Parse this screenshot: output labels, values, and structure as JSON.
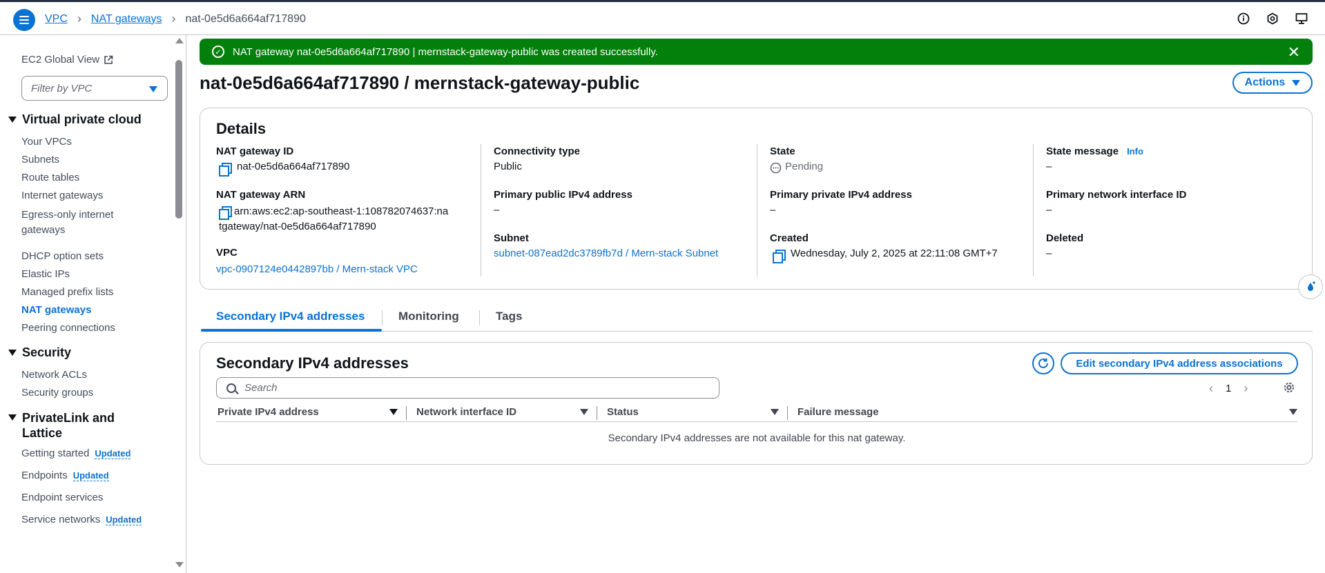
{
  "breadcrumb": {
    "items": [
      "VPC",
      "NAT gateways"
    ],
    "current": "nat-0e5d6a664af717890"
  },
  "sidebar": {
    "global_view": "EC2 Global View",
    "filter_placeholder": "Filter by VPC",
    "sections": [
      {
        "title": "Virtual private cloud",
        "items": [
          "Your VPCs",
          "Subnets",
          "Route tables",
          "Internet gateways",
          "Egress-only internet gateways",
          "DHCP option sets",
          "Elastic IPs",
          "Managed prefix lists",
          "NAT gateways",
          "Peering connections"
        ]
      },
      {
        "title": "Security",
        "items": [
          "Network ACLs",
          "Security groups"
        ]
      },
      {
        "title": "PrivateLink and Lattice",
        "items": [
          "Getting started",
          "Endpoints",
          "Endpoint services",
          "Service networks"
        ]
      }
    ],
    "active_item": "NAT gateways",
    "updated_badge": "Updated"
  },
  "flash": {
    "message": "NAT gateway nat-0e5d6a664af717890 | mernstack-gateway-public was created successfully."
  },
  "page": {
    "title": "nat-0e5d6a664af717890 / mernstack-gateway-public",
    "actions_label": "Actions"
  },
  "details": {
    "heading": "Details",
    "nat_gateway_id_label": "NAT gateway ID",
    "nat_gateway_id": "nat-0e5d6a664af717890",
    "arn_label": "NAT gateway ARN",
    "arn_line1": "arn:aws:ec2:ap-southeast-1:108782074637:na",
    "arn_line2": "tgateway/nat-0e5d6a664af717890",
    "vpc_label": "VPC",
    "vpc": "vpc-0907124e0442897bb / Mern-stack VPC",
    "connectivity_label": "Connectivity type",
    "connectivity": "Public",
    "public_ip_label": "Primary public IPv4 address",
    "public_ip": "–",
    "subnet_label": "Subnet",
    "subnet": "subnet-087ead2dc3789fb7d / Mern-stack Subnet",
    "state_label": "State",
    "state": "Pending",
    "private_ip_label": "Primary private IPv4 address",
    "private_ip": "–",
    "created_label": "Created",
    "created": "Wednesday, July 2, 2025 at 22:11:08 GMT+7",
    "state_message_label": "State message",
    "info_label": "Info",
    "state_message": "–",
    "network_interface_label": "Primary network interface ID",
    "network_interface": "–",
    "deleted_label": "Deleted",
    "deleted": "–"
  },
  "tabs": [
    "Secondary IPv4 addresses",
    "Monitoring",
    "Tags"
  ],
  "secondary": {
    "heading": "Secondary IPv4 addresses",
    "edit_button": "Edit secondary IPv4 address associations",
    "search_placeholder": "Search",
    "page_number": "1",
    "columns": [
      "Private IPv4 address",
      "Network interface ID",
      "Status",
      "Failure message"
    ],
    "empty_message": "Secondary IPv4 addresses are not available for this nat gateway."
  }
}
